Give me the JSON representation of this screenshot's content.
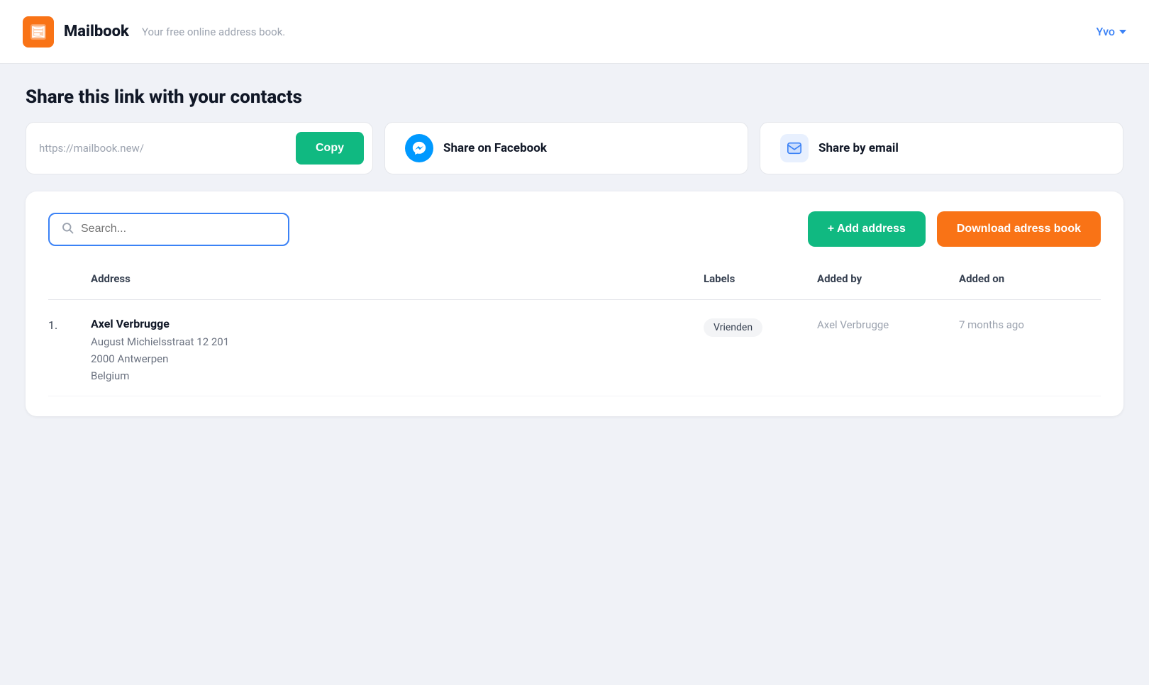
{
  "header": {
    "logo_icon": "📖",
    "app_title": "Mailbook",
    "app_subtitle": "Your free online address book.",
    "user_name": "Yvo"
  },
  "share": {
    "title": "Share this link with your contacts",
    "link_url": "https://mailbook.new/",
    "copy_label": "Copy",
    "facebook": {
      "label": "Share on Facebook"
    },
    "email": {
      "label": "Share by email"
    }
  },
  "search": {
    "placeholder": "Search..."
  },
  "toolbar": {
    "add_address_label": "+ Add address",
    "download_label": "Download adress book"
  },
  "table": {
    "columns": {
      "address": "Address",
      "labels": "Labels",
      "added_by": "Added by",
      "added_on": "Added on"
    },
    "rows": [
      {
        "number": "1.",
        "name": "Axel Verbrugge",
        "street": "August Michielsstraat 12 201",
        "city": "2000 Antwerpen",
        "country": "Belgium",
        "label": "Vrienden",
        "added_by": "Axel Verbrugge",
        "added_on": "7 months ago"
      }
    ]
  }
}
